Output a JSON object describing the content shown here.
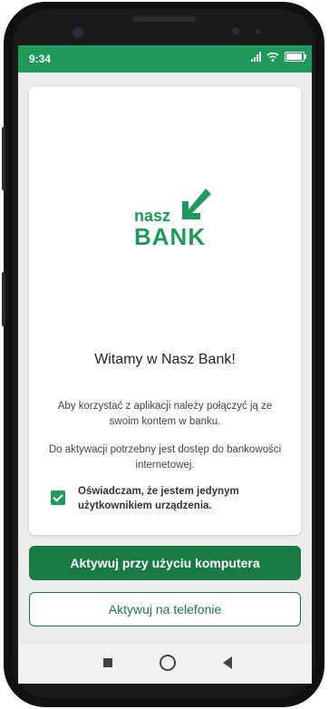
{
  "statusbar": {
    "time": "9:34",
    "signal_icon": "signal-icon",
    "wifi_icon": "wifi-icon",
    "battery_icon": "battery-icon",
    "battery_level": 1.0
  },
  "logo": {
    "line1": "nasz",
    "line2": "BANK",
    "icon": "arrow-down-left-icon",
    "color": "#1f9a5a"
  },
  "welcome": {
    "title": "Witamy w Nasz Bank!",
    "paragraph1": "Aby korzystać z aplikacji należy połączyć ją ze swoim kontem w banku.",
    "paragraph2": "Do aktywacji potrzebny jest dostęp do bankowości internetowej.",
    "consent_label": "Oświadczam, że jestem jedynym użytkownikiem urządzenia.",
    "consent_checked": true
  },
  "actions": {
    "primary_label": "Aktywuj przy użyciu komputera",
    "secondary_label": "Aktywuj na telefonie"
  },
  "navbar": {
    "recent_icon": "square-icon",
    "home_icon": "circle-icon",
    "back_icon": "triangle-back-icon"
  },
  "colors": {
    "brand": "#1f9a5a",
    "button_primary": "#1a7a46",
    "background": "#ececec"
  }
}
